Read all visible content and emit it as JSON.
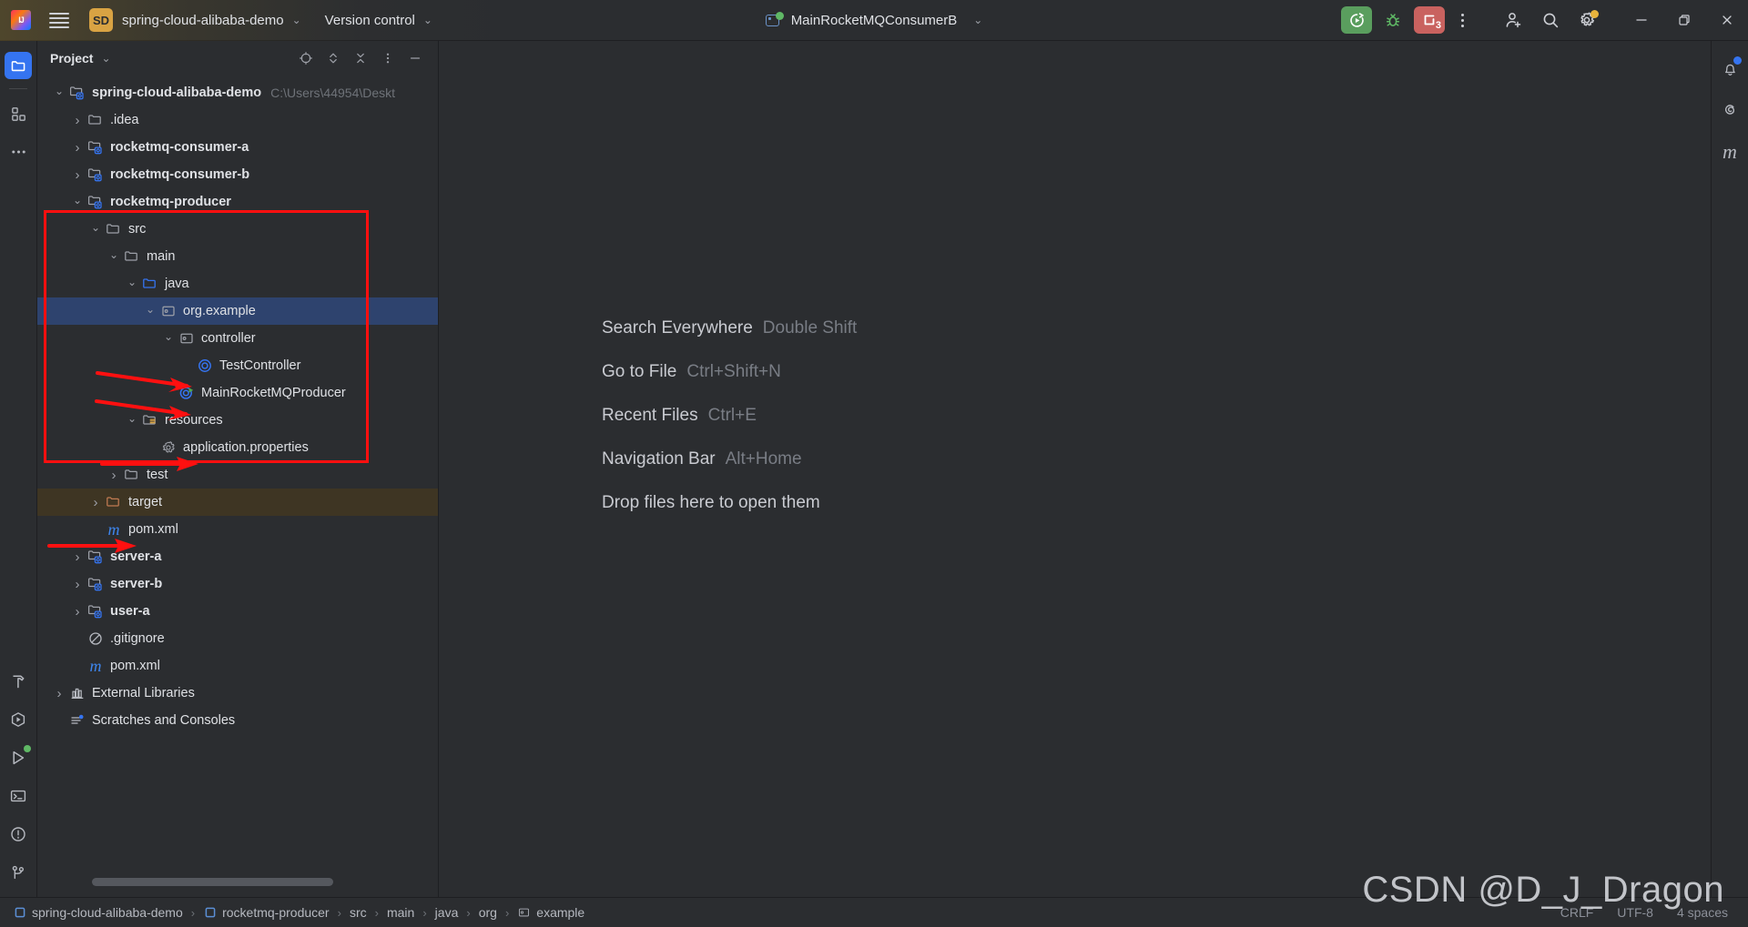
{
  "titlebar": {
    "logo_icon": "intellij-idea-logo",
    "menu_icon": "hamburger-menu-icon",
    "project_badge": "SD",
    "project_name": "spring-cloud-alibaba-demo",
    "project_chevron": "⌄",
    "version_control": "Version control",
    "version_control_chevron": "⌄",
    "run_config_name": "MainRocketMQConsumerB",
    "run_config_chevron": "⌄",
    "run_config_icon": "run-configuration-icon",
    "run_button_icon": "run-with-coverage-icon",
    "debug_button_icon": "debug-bug-icon",
    "stop_button_icon": "stop-process-icon",
    "stop_button_count": "3",
    "more_icon": "more-vertical-icon",
    "account_icon": "add-account-icon",
    "search_icon": "search-icon",
    "settings_icon": "gear-icon",
    "minimize_icon": "minimize-icon",
    "maximize_icon": "restore-icon",
    "close_icon": "close-icon"
  },
  "left_strip": {
    "top": [
      {
        "name": "project-tool-window",
        "icon": "folder-icon",
        "active": true
      },
      {
        "name": "structure-tool-window",
        "icon": "structure-icon",
        "active": false
      },
      {
        "name": "more-tool-windows",
        "icon": "more-horizontal-icon",
        "active": false
      }
    ],
    "bottom": [
      {
        "name": "build-tool-window",
        "icon": "hammer-icon"
      },
      {
        "name": "services-tool-window",
        "icon": "services-play-icon"
      },
      {
        "name": "run-tool-window",
        "icon": "run-play-icon",
        "badge": true
      },
      {
        "name": "terminal-tool-window",
        "icon": "terminal-icon"
      },
      {
        "name": "problems-tool-window",
        "icon": "warning-circle-icon"
      },
      {
        "name": "version-control-tool-window",
        "icon": "git-branch-icon"
      }
    ]
  },
  "right_strip": [
    {
      "name": "notifications",
      "icon": "bell-icon",
      "badge": true
    },
    {
      "name": "ai-assistant",
      "icon": "spiral-icon",
      "badge": false
    },
    {
      "name": "maven-tool-window",
      "icon": "maven-m-icon",
      "badge": false
    }
  ],
  "project_panel": {
    "title": "Project",
    "title_chevron": "⌄",
    "tools": [
      {
        "name": "select-opened-file-button",
        "icon": "crosshair-icon"
      },
      {
        "name": "expand-collapse-button",
        "icon": "expand-collapse-icon"
      },
      {
        "name": "collapse-all-button",
        "icon": "collapse-all-icon"
      },
      {
        "name": "panel-options-button",
        "icon": "more-vertical-icon"
      },
      {
        "name": "hide-panel-button",
        "icon": "minimize-icon"
      }
    ],
    "tree": [
      {
        "depth": 0,
        "arrow": "down",
        "icon": "module-folder-icon",
        "label": "spring-cloud-alibaba-demo",
        "bold": true,
        "path": "C:\\Users\\44954\\Deskt",
        "state": "normal"
      },
      {
        "depth": 1,
        "arrow": "right",
        "icon": "folder-icon",
        "label": ".idea",
        "bold": false,
        "state": "normal"
      },
      {
        "depth": 1,
        "arrow": "right",
        "icon": "module-folder-icon",
        "label": "rocketmq-consumer-a",
        "bold": true,
        "state": "normal"
      },
      {
        "depth": 1,
        "arrow": "right",
        "icon": "module-folder-icon",
        "label": "rocketmq-consumer-b",
        "bold": true,
        "state": "normal"
      },
      {
        "depth": 1,
        "arrow": "down",
        "icon": "module-folder-icon",
        "label": "rocketmq-producer",
        "bold": true,
        "state": "normal"
      },
      {
        "depth": 2,
        "arrow": "down",
        "icon": "folder-icon",
        "label": "src",
        "bold": false,
        "state": "normal"
      },
      {
        "depth": 3,
        "arrow": "down",
        "icon": "folder-icon",
        "label": "main",
        "bold": false,
        "state": "normal"
      },
      {
        "depth": 4,
        "arrow": "down",
        "icon": "source-folder-icon",
        "label": "java",
        "bold": false,
        "state": "normal"
      },
      {
        "depth": 5,
        "arrow": "down",
        "icon": "package-icon",
        "label": "org.example",
        "bold": false,
        "state": "selected"
      },
      {
        "depth": 6,
        "arrow": "down",
        "icon": "package-icon",
        "label": "controller",
        "bold": false,
        "state": "normal"
      },
      {
        "depth": 7,
        "arrow": "none",
        "icon": "java-class-icon",
        "label": "TestController",
        "bold": false,
        "state": "normal"
      },
      {
        "depth": 6,
        "arrow": "none",
        "icon": "java-runnable-class-icon",
        "label": "MainRocketMQProducer",
        "bold": false,
        "state": "normal"
      },
      {
        "depth": 4,
        "arrow": "down",
        "icon": "resources-folder-icon",
        "label": "resources",
        "bold": false,
        "state": "normal"
      },
      {
        "depth": 5,
        "arrow": "none",
        "icon": "properties-file-icon",
        "label": "application.properties",
        "bold": false,
        "state": "normal"
      },
      {
        "depth": 3,
        "arrow": "right",
        "icon": "folder-icon",
        "label": "test",
        "bold": false,
        "state": "normal"
      },
      {
        "depth": 2,
        "arrow": "right",
        "icon": "excluded-folder-icon",
        "label": "target",
        "bold": false,
        "state": "target"
      },
      {
        "depth": 2,
        "arrow": "none",
        "icon": "maven-m-icon",
        "label": "pom.xml",
        "bold": false,
        "state": "normal"
      },
      {
        "depth": 1,
        "arrow": "right",
        "icon": "module-folder-icon",
        "label": "server-a",
        "bold": true,
        "state": "normal"
      },
      {
        "depth": 1,
        "arrow": "right",
        "icon": "module-folder-icon",
        "label": "server-b",
        "bold": true,
        "state": "normal"
      },
      {
        "depth": 1,
        "arrow": "right",
        "icon": "module-folder-icon",
        "label": "user-a",
        "bold": true,
        "state": "normal"
      },
      {
        "depth": 1,
        "arrow": "none",
        "icon": "gitignore-file-icon",
        "label": ".gitignore",
        "bold": false,
        "state": "normal"
      },
      {
        "depth": 1,
        "arrow": "none",
        "icon": "maven-m-icon",
        "label": "pom.xml",
        "bold": false,
        "state": "normal"
      },
      {
        "depth": 0,
        "arrow": "right",
        "icon": "external-libraries-icon",
        "label": "External Libraries",
        "bold": false,
        "state": "normal"
      },
      {
        "depth": 0,
        "arrow": "none",
        "icon": "scratches-icon",
        "label": "Scratches and Consoles",
        "bold": false,
        "state": "normal"
      }
    ],
    "annotation": {
      "box_color": "#FF0F0F",
      "arrow_color": "#FF1010",
      "arrow_targets": [
        "TestController",
        "MainRocketMQProducer",
        "application.properties",
        "pom.xml"
      ]
    }
  },
  "editor": {
    "hints": [
      {
        "label": "Search Everywhere",
        "key": "Double Shift"
      },
      {
        "label": "Go to File",
        "key": "Ctrl+Shift+N"
      },
      {
        "label": "Recent Files",
        "key": "Ctrl+E"
      },
      {
        "label": "Navigation Bar",
        "key": "Alt+Home"
      }
    ],
    "drop_hint": "Drop files here to open them"
  },
  "statusbar": {
    "breadcrumb": [
      {
        "label": "spring-cloud-alibaba-demo",
        "icon": "module-square-icon"
      },
      {
        "label": "rocketmq-producer",
        "icon": "module-square-icon"
      },
      {
        "label": "src",
        "icon": "none"
      },
      {
        "label": "main",
        "icon": "none"
      },
      {
        "label": "java",
        "icon": "none"
      },
      {
        "label": "org",
        "icon": "none"
      },
      {
        "label": "example",
        "icon": "package-icon"
      }
    ],
    "separator": "›",
    "line_separator": "CRLF",
    "encoding": "UTF-8",
    "indent": "4 spaces"
  },
  "watermark": "CSDN @D_J_Dragon",
  "colors": {
    "background": "#2B2D30",
    "selection": "#2E436E",
    "excluded_row": "#3E3523",
    "accent_blue": "#3574F0",
    "run_green": "#5A9E5E",
    "stop_red": "#C9625F",
    "badge_gold": "#D9A343",
    "annotation_red": "#FF0F0F"
  }
}
